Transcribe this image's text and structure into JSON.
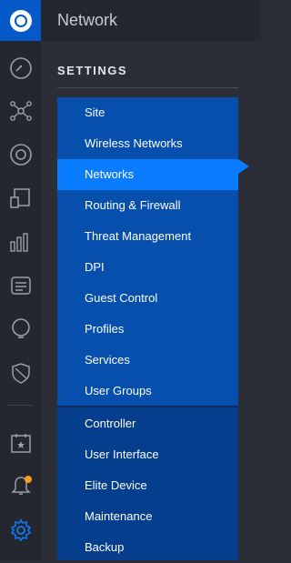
{
  "header": {
    "title": "Network"
  },
  "settings": {
    "section_label": "SETTINGS",
    "items": [
      {
        "label": "Site"
      },
      {
        "label": "Wireless Networks"
      },
      {
        "label": "Networks",
        "active": true
      },
      {
        "label": "Routing & Firewall"
      },
      {
        "label": "Threat Management"
      },
      {
        "label": "DPI"
      },
      {
        "label": "Guest Control"
      },
      {
        "label": "Profiles"
      },
      {
        "label": "Services"
      },
      {
        "label": "User Groups"
      },
      {
        "label": "Controller"
      },
      {
        "label": "User Interface"
      },
      {
        "label": "Elite Device"
      },
      {
        "label": "Maintenance"
      },
      {
        "label": "Backup"
      }
    ]
  },
  "rail": {
    "icons": [
      "dashboard-icon",
      "topology-icon",
      "devices-icon",
      "clients-icon",
      "statistics-icon",
      "insights-icon",
      "map-icon",
      "security-icon",
      "events-icon",
      "alerts-icon",
      "settings-icon"
    ],
    "accent_color": "#0a7cff",
    "alert_dot_color": "#f3a01b"
  }
}
